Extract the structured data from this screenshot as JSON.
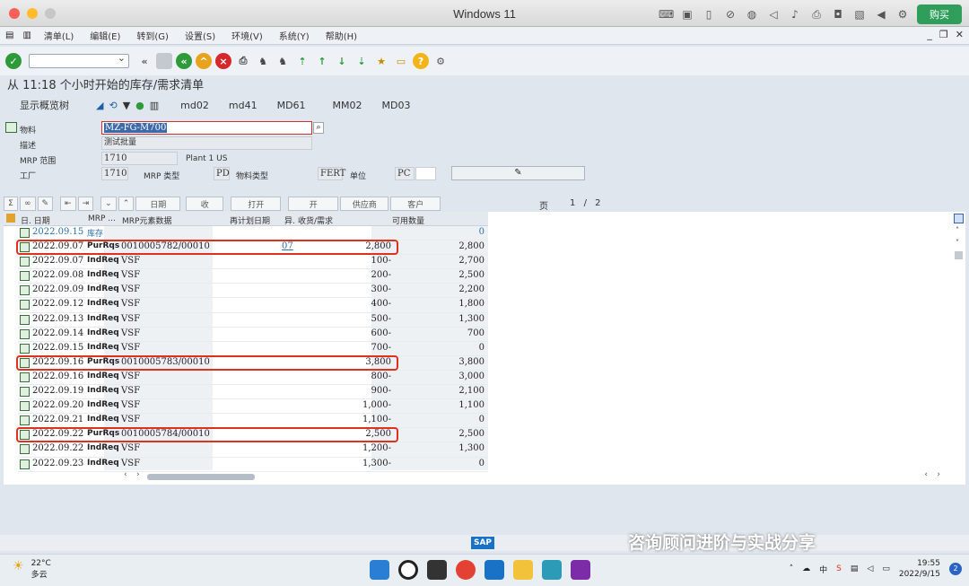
{
  "window": {
    "title": "Windows 11",
    "buy_label": "购买"
  },
  "menu": [
    "清单(L)",
    "编辑(E)",
    "转到(G)",
    "设置(S)",
    "环境(V)",
    "系统(Y)",
    "帮助(H)"
  ],
  "page_title": "从 11:18 个小时开始的库存/需求清单",
  "app_toolbar": {
    "overview": "显示概览树",
    "buttons": [
      "md02",
      "md41",
      "MD61",
      "MM02",
      "MD03"
    ]
  },
  "header": {
    "material_label": "物料",
    "material_value": "MZ-FG-M700",
    "desc_label": "描述",
    "desc_value": "测试批量",
    "mrp_area_label": "MRP 范围",
    "mrp_area_value": "1710",
    "mrp_area_text": "Plant 1 US",
    "plant_label": "工厂",
    "plant_value": "1710",
    "mrp_type_label": "MRP 类型",
    "mrp_type_value": "PD",
    "mat_type_label": "物料类型",
    "mat_type_value": "FERT",
    "unit_label": "单位",
    "unit_value": "PC"
  },
  "grid_toolbar": {
    "date": "日期",
    "receipt": "收",
    "open": "打开",
    "in": "开",
    "vendor": "供应商",
    "customer": "客户"
  },
  "pager": {
    "label": "页",
    "current": "1",
    "sep": "/",
    "total": "2"
  },
  "columns": {
    "date": "日. 日期",
    "mrp": "MRP ...",
    "element": "MRP元素数据",
    "resched": "再计划日期",
    "exc": "异.",
    "qty": "收货/需求",
    "avail": "可用数量"
  },
  "rows": [
    {
      "date": "2022.09.15",
      "type": "库存",
      "data": "",
      "exc": "",
      "qty": "",
      "avail": "0",
      "hl": false,
      "stock": true
    },
    {
      "date": "2022.09.07",
      "type": "PurRqs",
      "data": "0010005782/00010",
      "exc": "07",
      "qty": "2,800",
      "avail": "2,800",
      "hl": true
    },
    {
      "date": "2022.09.07",
      "type": "IndReq",
      "data": "VSF",
      "exc": "",
      "qty": "100-",
      "avail": "2,700",
      "hl": false
    },
    {
      "date": "2022.09.08",
      "type": "IndReq",
      "data": "VSF",
      "exc": "",
      "qty": "200-",
      "avail": "2,500",
      "hl": false
    },
    {
      "date": "2022.09.09",
      "type": "IndReq",
      "data": "VSF",
      "exc": "",
      "qty": "300-",
      "avail": "2,200",
      "hl": false
    },
    {
      "date": "2022.09.12",
      "type": "IndReq",
      "data": "VSF",
      "exc": "",
      "qty": "400-",
      "avail": "1,800",
      "hl": false
    },
    {
      "date": "2022.09.13",
      "type": "IndReq",
      "data": "VSF",
      "exc": "",
      "qty": "500-",
      "avail": "1,300",
      "hl": false
    },
    {
      "date": "2022.09.14",
      "type": "IndReq",
      "data": "VSF",
      "exc": "",
      "qty": "600-",
      "avail": "700",
      "hl": false
    },
    {
      "date": "2022.09.15",
      "type": "IndReq",
      "data": "VSF",
      "exc": "",
      "qty": "700-",
      "avail": "0",
      "hl": false
    },
    {
      "date": "2022.09.16",
      "type": "PurRqs",
      "data": "0010005783/00010",
      "exc": "",
      "qty": "3,800",
      "avail": "3,800",
      "hl": true
    },
    {
      "date": "2022.09.16",
      "type": "IndReq",
      "data": "VSF",
      "exc": "",
      "qty": "800-",
      "avail": "3,000",
      "hl": false
    },
    {
      "date": "2022.09.19",
      "type": "IndReq",
      "data": "VSF",
      "exc": "",
      "qty": "900-",
      "avail": "2,100",
      "hl": false
    },
    {
      "date": "2022.09.20",
      "type": "IndReq",
      "data": "VSF",
      "exc": "",
      "qty": "1,000-",
      "avail": "1,100",
      "hl": false
    },
    {
      "date": "2022.09.21",
      "type": "IndReq",
      "data": "VSF",
      "exc": "",
      "qty": "1,100-",
      "avail": "0",
      "hl": false
    },
    {
      "date": "2022.09.22",
      "type": "PurRqs",
      "data": "0010005784/00010",
      "exc": "",
      "qty": "2,500",
      "avail": "2,500",
      "hl": true
    },
    {
      "date": "2022.09.22",
      "type": "IndReq",
      "data": "VSF",
      "exc": "",
      "qty": "1,200-",
      "avail": "1,300",
      "hl": false
    },
    {
      "date": "2022.09.23",
      "type": "IndReq",
      "data": "VSF",
      "exc": "",
      "qty": "1,300-",
      "avail": "0",
      "hl": false
    }
  ],
  "watermark": "咨询顾问进阶与实战分享",
  "taskbar": {
    "temp": "22°C",
    "weather": "多云",
    "time": "19:55",
    "date": "2022/9/15",
    "notifications": "2"
  },
  "colors": {
    "highlight": "#e0301e",
    "accent": "#1a72c6"
  }
}
